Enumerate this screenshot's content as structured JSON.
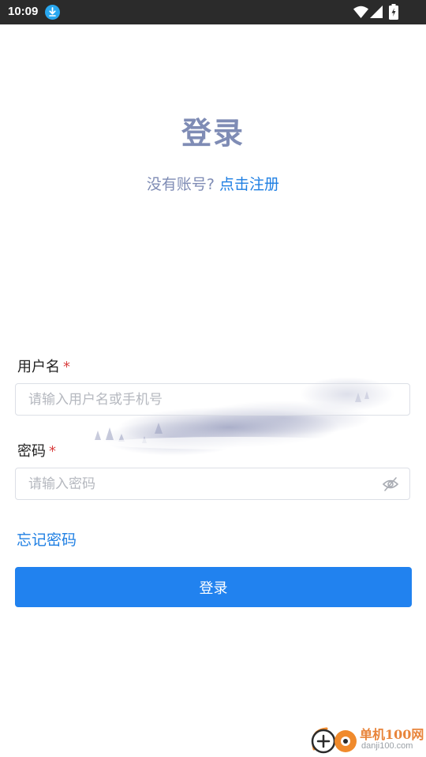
{
  "status_bar": {
    "time": "10:09",
    "icons": [
      "download-icon",
      "wifi-icon",
      "signal-icon",
      "battery-charging-icon"
    ]
  },
  "header": {
    "title": "登录",
    "register_prompt": "没有账号? ",
    "register_link": "点击注册"
  },
  "form": {
    "username": {
      "label": "用户名",
      "required_mark": "*",
      "placeholder": "请输入用户名或手机号",
      "value": ""
    },
    "password": {
      "label": "密码",
      "required_mark": "*",
      "placeholder": "请输入密码",
      "value": "",
      "visibility_icon": "eye-off-icon"
    },
    "forgot_password": "忘记密码",
    "submit_label": "登录"
  },
  "watermark": {
    "name_cn": "单机100网",
    "domain": "danji100.com"
  },
  "colors": {
    "title": "#7f8cb5",
    "link": "#1f7fe3",
    "primary_button": "#2182ef",
    "required": "#d93f3f",
    "status_bar": "#2b2b2b"
  }
}
